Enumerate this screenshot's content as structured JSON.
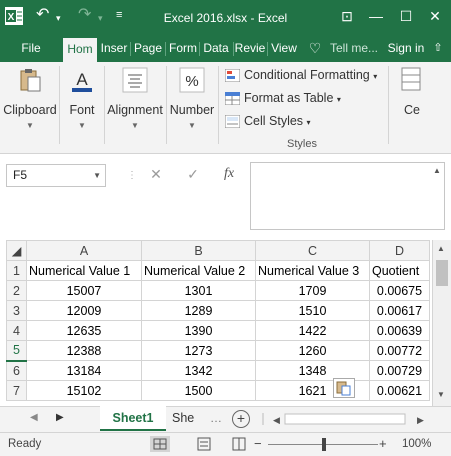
{
  "window": {
    "title": "Excel 2016.xlsx - Excel"
  },
  "quick_access": {
    "undo_icon": "undo-icon",
    "redo_icon": "redo-icon",
    "customize_icon": "customize-icon"
  },
  "tabs": [
    {
      "label": "File",
      "active": false
    },
    {
      "label": "Hom",
      "active": true
    },
    {
      "label": "Inser",
      "active": false
    },
    {
      "label": "Page",
      "active": false
    },
    {
      "label": "Form",
      "active": false
    },
    {
      "label": "Data",
      "active": false
    },
    {
      "label": "Revie",
      "active": false
    },
    {
      "label": "View",
      "active": false
    }
  ],
  "tell_me": "Tell me...",
  "sign_in": "Sign in",
  "ribbon": {
    "groups": [
      {
        "label": "Clipboard",
        "icon": "clipboard-icon"
      },
      {
        "label": "Font",
        "icon": "font-icon"
      },
      {
        "label": "Alignment",
        "icon": "alignment-icon"
      },
      {
        "label": "Number",
        "icon": "percent-icon"
      }
    ],
    "styles": {
      "conditional": "Conditional Formatting",
      "format_table": "Format as Table",
      "cell_styles": "Cell Styles",
      "group_label": "Styles"
    },
    "cells_label": "Ce"
  },
  "formula_bar": {
    "name_box": "F5",
    "formula": "",
    "fx": "fx"
  },
  "grid": {
    "columns": [
      "A",
      "B",
      "C",
      "D"
    ],
    "rows": [
      {
        "n": "1",
        "cells": [
          "Numerical Value 1",
          "Numerical Value 2",
          "Numerical Value 3",
          "Quotient"
        ]
      },
      {
        "n": "2",
        "cells": [
          "15007",
          "1301",
          "1709",
          "0.00675"
        ]
      },
      {
        "n": "3",
        "cells": [
          "12009",
          "1289",
          "1510",
          "0.00617"
        ]
      },
      {
        "n": "4",
        "cells": [
          "12635",
          "1390",
          "1422",
          "0.00639"
        ]
      },
      {
        "n": "5",
        "cells": [
          "12388",
          "1273",
          "1260",
          "0.00772"
        ]
      },
      {
        "n": "6",
        "cells": [
          "13184",
          "1342",
          "1348",
          "0.00729"
        ]
      },
      {
        "n": "7",
        "cells": [
          "15102",
          "1500",
          "1621",
          "0.00621"
        ]
      }
    ]
  },
  "sheets": {
    "active": "Sheet1",
    "other": "She"
  },
  "status": {
    "ready": "Ready",
    "zoom": "100%"
  },
  "colors": {
    "accent": "#217346"
  }
}
